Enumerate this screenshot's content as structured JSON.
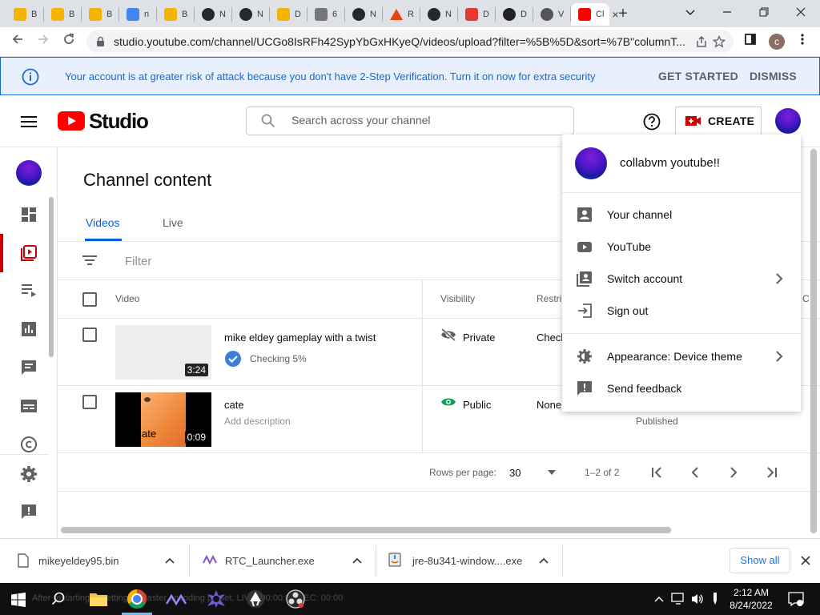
{
  "browser": {
    "tabs": [
      {
        "label": "B",
        "icon": "smiley-favicon",
        "color": "#f4b400"
      },
      {
        "label": "B",
        "icon": "smiley-favicon",
        "color": "#f4b400"
      },
      {
        "label": "B",
        "icon": "smiley-favicon",
        "color": "#f4b400"
      },
      {
        "label": "n",
        "icon": "google-favicon",
        "color": "#4285f4"
      },
      {
        "label": "B",
        "icon": "smiley-favicon",
        "color": "#f4b400"
      },
      {
        "label": "N",
        "icon": "github-favicon",
        "color": "#24292e"
      },
      {
        "label": "N",
        "icon": "github-favicon",
        "color": "#24292e"
      },
      {
        "label": "D",
        "icon": "smiley-favicon",
        "color": "#f4b400"
      },
      {
        "label": "6",
        "icon": "doc-favicon",
        "color": "#777777"
      },
      {
        "label": "N",
        "icon": "github-favicon",
        "color": "#24292e"
      },
      {
        "label": "R",
        "icon": "triangle-favicon",
        "color": "#e8430b"
      },
      {
        "label": "N",
        "icon": "github-favicon",
        "color": "#24292e"
      },
      {
        "label": "D",
        "icon": "window-favicon",
        "color": "#e53935"
      },
      {
        "label": "D",
        "icon": "obs-favicon",
        "color": "#222222"
      },
      {
        "label": "V",
        "icon": "globe-favicon",
        "color": "#555555"
      },
      {
        "label": "Cl",
        "icon": "studio-favicon",
        "color": "#ff0000"
      }
    ],
    "url": "studio.youtube.com/channel/UCGo8IsRFh42SypYbGxHKyeQ/videos/upload?filter=%5B%5D&sort=%7B\"columnT...",
    "profile_initial": "c"
  },
  "banner": {
    "text": "Your account is at greater risk of attack because you don't have 2-Step Verification. Turn it on now for extra security",
    "get_started": "GET STARTED",
    "dismiss": "DISMISS"
  },
  "header": {
    "logo_text": "Studio",
    "search_placeholder": "Search across your channel",
    "create_label": "CREATE"
  },
  "content": {
    "title": "Channel content",
    "tabs": [
      "Videos",
      "Live"
    ],
    "filter_label": "Filter",
    "columns": {
      "video": "Video",
      "visibility": "Visibility",
      "restrictions": "Restri",
      "extra": "C"
    },
    "rows": [
      {
        "title": "mike eldey gameplay with a twist",
        "status": "Checking 5%",
        "duration": "3:24",
        "visibility": "Private",
        "restriction": "Check",
        "date_label": ""
      },
      {
        "title": "cate",
        "status": "Add description",
        "duration": "0:09",
        "visibility": "Public",
        "restriction": "None",
        "date_label": "Published",
        "thumb_text": "ate"
      }
    ],
    "pager": {
      "rows_label": "Rows per page:",
      "rows_value": "30",
      "range": "1–2 of 2"
    }
  },
  "account_menu": {
    "name": "collabvm youtube!!",
    "items": [
      "Your channel",
      "YouTube",
      "Switch account",
      "Sign out"
    ],
    "items2": [
      "Appearance: Device theme",
      "Send feedback"
    ]
  },
  "downloads": {
    "items": [
      "mikeyeldey95.bin",
      "RTC_Launcher.exe",
      "jre-8u341-window....exe"
    ],
    "show_all": "Show all"
  },
  "taskbar": {
    "ghost_text": "After restarting ... settings ... faster encoding preset.    LIVE: 00:00:00    REC: 00:00",
    "time": "2:12 AM",
    "date": "8/24/2022"
  },
  "colors": {
    "brand_red": "#ff0000",
    "accent_blue": "#065fd4",
    "banner_blue": "#1967d2",
    "public_green": "#0f9d58"
  }
}
